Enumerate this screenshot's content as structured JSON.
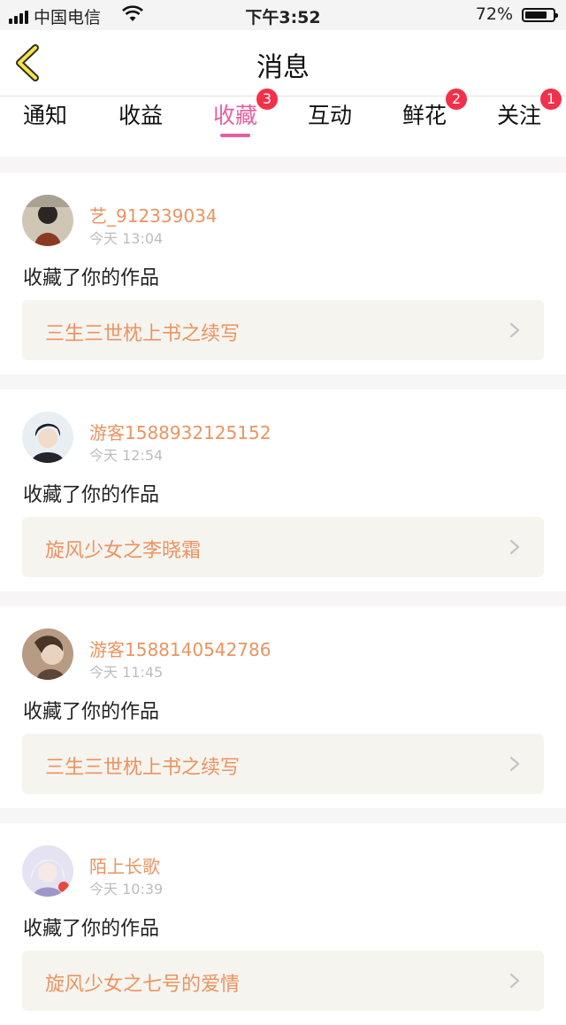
{
  "status_bar": {
    "carrier": "中国电信",
    "time": "下午3:52",
    "battery": "72%",
    "battery_level": 0.72
  },
  "header": {
    "title": "消息",
    "back_icon": "chevron-left-icon"
  },
  "tabs": [
    {
      "label": "通知",
      "badge": "",
      "active": false
    },
    {
      "label": "收益",
      "badge": "",
      "active": false
    },
    {
      "label": "收藏",
      "badge": "3",
      "active": true
    },
    {
      "label": "互动",
      "badge": "",
      "active": false
    },
    {
      "label": "鲜花",
      "badge": "2",
      "active": false
    },
    {
      "label": "关注",
      "badge": "1",
      "active": false
    }
  ],
  "colors": {
    "accent": "#e75ea0",
    "badge": "#f2304a",
    "username": "#ec9360",
    "link_bg": "#f6f4ef"
  },
  "messages": [
    {
      "username": "艺_912339034",
      "time": "今天 13:04",
      "action": "收藏了你的作品",
      "work": "三生三世枕上书之续写"
    },
    {
      "username": "游客1588932125152",
      "time": "今天 12:54",
      "action": "收藏了你的作品",
      "work": "旋风少女之李晓霜"
    },
    {
      "username": "游客1588140542786",
      "time": "今天 11:45",
      "action": "收藏了你的作品",
      "work": "三生三世枕上书之续写"
    },
    {
      "username": "陌上长歌",
      "time": "今天 10:39",
      "action": "收藏了你的作品",
      "work": "旋风少女之七号的爱情"
    }
  ]
}
